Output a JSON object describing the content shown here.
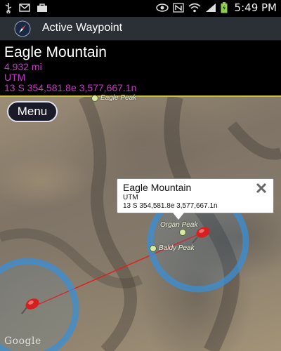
{
  "status_bar": {
    "time": "5:49 PM",
    "left_icons": [
      "usb-icon",
      "email-icon",
      "bag-icon"
    ],
    "right_icons": [
      "eye-icon",
      "nfc-icon",
      "wifi-icon",
      "signal-icon",
      "battery-icon"
    ]
  },
  "action_bar": {
    "title": "Active Waypoint",
    "icon": "compass-icon"
  },
  "waypoint": {
    "name": "Eagle Mountain",
    "distance": "4.932 mi",
    "coord_system": "UTM",
    "coordinates": "13 S 354,581.8e 3,577,667.1n"
  },
  "menu": {
    "label": "Menu"
  },
  "map": {
    "labels": {
      "top_peak": "Eagle Peak",
      "organ_peak": "Organ Peak",
      "baldy_peak": "Baldy Peak"
    },
    "attribution": "Google",
    "colors": {
      "route_line": "#e02020",
      "radius_circle": "#3a8fd6",
      "marker": "#d42020"
    }
  },
  "info_window": {
    "title": "Eagle Mountain",
    "coord_system": "UTM",
    "coordinates": "13 S 354,581.8e 3,577,667.1n",
    "close_icon": "close-icon"
  }
}
